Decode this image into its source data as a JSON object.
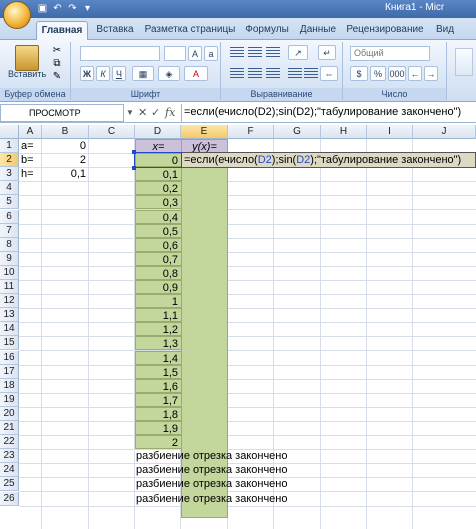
{
  "window": {
    "title": "Книга1 - Micr"
  },
  "tabs": [
    "Главная",
    "Вставка",
    "Разметка страницы",
    "Формулы",
    "Данные",
    "Рецензирование",
    "Вид"
  ],
  "ribbon": {
    "paste_label": "Вставить",
    "font_buttons": [
      "Ж",
      "К",
      "Ч"
    ],
    "number_format": "Общий",
    "groups": [
      "Буфер обмена",
      "Шрифт",
      "Выравнивание",
      "Число"
    ]
  },
  "formula_bar": {
    "name_box": "ПРОСМОТР",
    "fx_label": "fx",
    "cancel_glyph": "✕",
    "enter_glyph": "✓",
    "formula": "=если(ечисло(D2);sin(D2);\"табулирование закончено\")"
  },
  "columns": [
    "A",
    "B",
    "C",
    "D",
    "E",
    "F",
    "G",
    "H",
    "I",
    "J"
  ],
  "rows": [
    "1",
    "2",
    "3",
    "4",
    "5",
    "6",
    "7",
    "8",
    "9",
    "10",
    "11",
    "12",
    "13",
    "14",
    "15",
    "16",
    "17",
    "18",
    "19",
    "20",
    "21",
    "22",
    "23",
    "24",
    "25",
    "26"
  ],
  "sheet": {
    "labels": {
      "a": "a=",
      "b": "b=",
      "h": "h="
    },
    "params": {
      "a": "0",
      "b": "2",
      "h": "0,1"
    },
    "d_header": "x=",
    "e_header": "y(x)=",
    "x_values": [
      "0",
      "0,1",
      "0,2",
      "0,3",
      "0,4",
      "0,5",
      "0,6",
      "0,7",
      "0,8",
      "0,9",
      "1",
      "1,1",
      "1,2",
      "1,3",
      "1,4",
      "1,5",
      "1,6",
      "1,7",
      "1,8",
      "1,9",
      "2"
    ],
    "formula_parts": [
      "=если(ечисло(",
      "D2",
      ");sin(",
      "D2",
      ");\"табулирование закончено\")"
    ],
    "finished_text": "разбиение отрезка закончено"
  },
  "colors": {
    "green_cells": "#c3d69b",
    "purple_cells": "#ccc0da",
    "ref_highlight": "#1f49c9"
  }
}
